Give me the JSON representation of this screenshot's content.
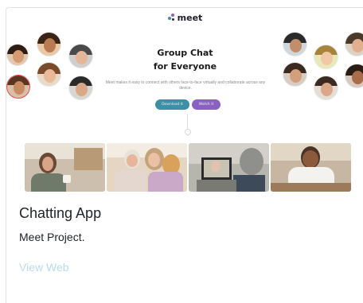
{
  "preview": {
    "logo_text": "meet",
    "hero_line1": "Group Chat",
    "hero_line2": "for Everyone",
    "hero_subtitle": "Meet makes it easy to connect with others face-to-face virtually and collaborate across any device.",
    "button_primary": "Download it",
    "button_secondary": "Watch it",
    "photos": [
      "woman-with-coffee",
      "family-group",
      "video-call-laptop",
      "man-on-laptop"
    ]
  },
  "card": {
    "title": "Chatting App",
    "text": "Meet Project.",
    "link": "View Web"
  },
  "colors": {
    "accent_teal": "#3c8fa4",
    "accent_purple": "#8a60c2",
    "link": "#b7dced"
  }
}
